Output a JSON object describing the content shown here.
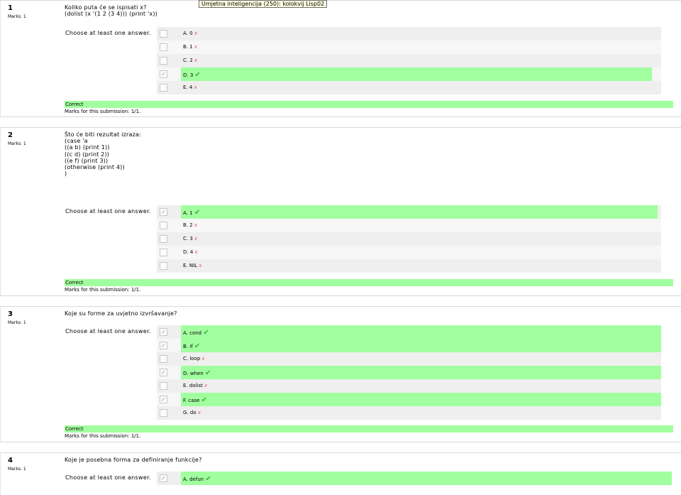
{
  "tooltip": "Umjetna inteligencija (250): kolokvij Lisp02",
  "questions": [
    {
      "number": "1",
      "marks": "Marks: 1",
      "text": "Koliko puta će se ispisati x?\n(dolist (x '(1 2 (3 4))) (print 'x))",
      "prompt": "Choose at least one answer.",
      "answers": [
        {
          "label": "A. 0",
          "checked": false,
          "correct": false
        },
        {
          "label": "B. 1",
          "checked": false,
          "correct": false
        },
        {
          "label": "C. 2",
          "checked": false,
          "correct": false
        },
        {
          "label": "D. 3",
          "checked": true,
          "correct": true
        },
        {
          "label": "E. 4",
          "checked": false,
          "correct": false
        }
      ],
      "result": "Correct",
      "submission": "Marks for this submission: 1/1."
    },
    {
      "number": "2",
      "marks": "Marks: 1",
      "text": "Što će biti rezultat izraza:\n(case 'a\n((a b) (print 1))\n((c d) (print 2))\n((e f) (print 3))\n(otherwise (print 4))\n)",
      "prompt": "Choose at least one answer.",
      "answers": [
        {
          "label": "A. 1",
          "checked": true,
          "correct": true
        },
        {
          "label": "B. 2",
          "checked": false,
          "correct": false
        },
        {
          "label": "C. 3",
          "checked": false,
          "correct": false
        },
        {
          "label": "D. 4",
          "checked": false,
          "correct": false
        },
        {
          "label": "E. NIL",
          "checked": false,
          "correct": false
        }
      ],
      "result": "Correct",
      "submission": "Marks for this submission: 1/1."
    },
    {
      "number": "3",
      "marks": "Marks: 1",
      "text": "Koje su forme za uvjetno izvršavanje?",
      "prompt": "Choose at least one answer.",
      "answers": [
        {
          "label": "A. cond",
          "checked": true,
          "correct": true
        },
        {
          "label": "B. if",
          "checked": true,
          "correct": true
        },
        {
          "label": "C. loop",
          "checked": false,
          "correct": false
        },
        {
          "label": "D. when",
          "checked": true,
          "correct": true
        },
        {
          "label": "E. dolist",
          "checked": false,
          "correct": false
        },
        {
          "label": "F. case",
          "checked": true,
          "correct": true
        },
        {
          "label": "G. do",
          "checked": false,
          "correct": false
        }
      ],
      "result": "Correct",
      "submission": "Marks for this submission: 1/1."
    },
    {
      "number": "4",
      "marks": "Marks: 1",
      "text": "Koje je posebna forma za definiranje funkcije?",
      "prompt": "Choose at least one answer.",
      "answers": [
        {
          "label": "A. defun",
          "checked": true,
          "correct": true
        }
      ],
      "result": "",
      "submission": ""
    }
  ],
  "icons": {
    "correct": "check-icon",
    "incorrect": "cross-icon"
  },
  "colors": {
    "highlight": "#a1ff9f",
    "check": "#39b52f",
    "cross": "#e25555"
  }
}
